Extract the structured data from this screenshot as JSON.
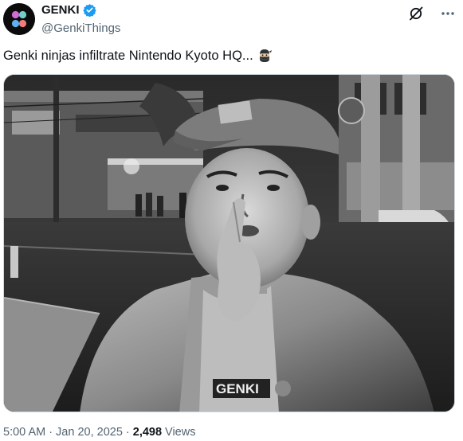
{
  "author": {
    "display_name": "GENKI",
    "handle": "@GenkiThings",
    "verified": true,
    "avatar_icon": "genki-logo-icon"
  },
  "actions": {
    "grok_icon": "grok-icon",
    "more_icon": "more-icon"
  },
  "tweet": {
    "text": "Genki ninjas infiltrate Nintendo Kyoto HQ...",
    "emoji_icon": "ninja-emoji-icon"
  },
  "media": {
    "shirt_text": "GENKI"
  },
  "meta": {
    "time": "5:00 AM",
    "separator_1": "·",
    "date": "Jan 20, 2025",
    "separator_2": "·",
    "views_count": "2,498",
    "views_label": "Views"
  },
  "colors": {
    "text_primary": "#0f1419",
    "text_secondary": "#536471",
    "verified_blue": "#1d9bf0",
    "border": "#cfd9de"
  }
}
